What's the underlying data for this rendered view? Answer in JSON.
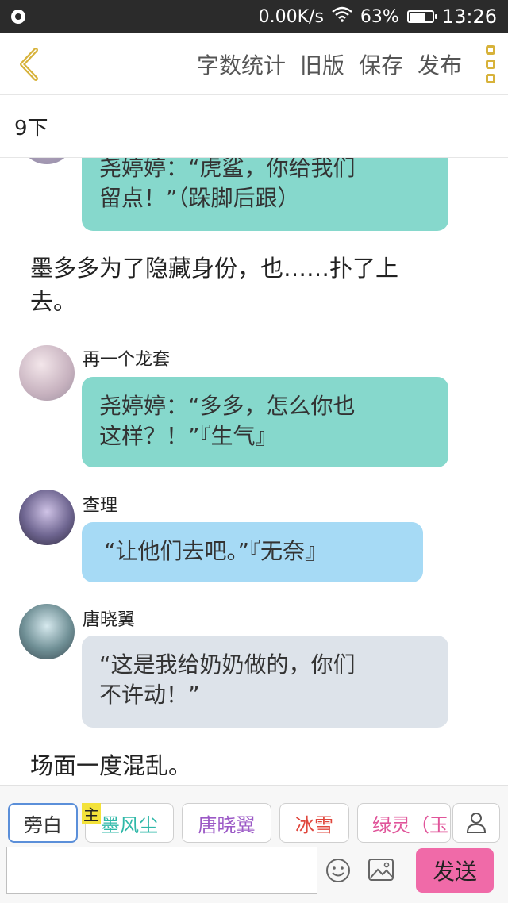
{
  "status_bar": {
    "network_speed": "0.00K/s",
    "battery": "63%",
    "battery_level": 0.63,
    "time": "13:26"
  },
  "toolbar": {
    "word_count": "字数统计",
    "old_version": "旧版",
    "save": "保存",
    "publish": "发布"
  },
  "chapter": {
    "title": "9下"
  },
  "messages": {
    "m1": {
      "text_line1": "尧婷婷：“虎鲨，你给我们",
      "text_line2": "留点！”（跺脚后跟）"
    },
    "n1": {
      "line1": "墨多多为了隐藏身份，也……扑了上",
      "line2": "去。"
    },
    "m2": {
      "speaker": "再一个龙套",
      "text_line1": "尧婷婷：“多多，怎么你也",
      "text_line2": "这样？！”『生气』"
    },
    "m3": {
      "speaker": "查理",
      "text": "“让他们去吧。”『无奈』"
    },
    "m4": {
      "speaker": "唐晓翼",
      "text_line1": "“这是我给奶奶做的，你们",
      "text_line2": "不许动！”"
    },
    "n2": {
      "text": "场面一度混乱。"
    }
  },
  "characters": {
    "narration": "旁白",
    "main_badge": "主",
    "c1": "墨风尘",
    "c2": "唐晓翼",
    "c3": "冰雪",
    "c4": "绿灵（玉",
    "colors": {
      "c1": "#2fb8a8",
      "c2": "#9b59c6",
      "c3": "#e0473d",
      "c4": "#e0559a"
    }
  },
  "input": {
    "value": "",
    "placeholder": "",
    "send": "发送"
  }
}
